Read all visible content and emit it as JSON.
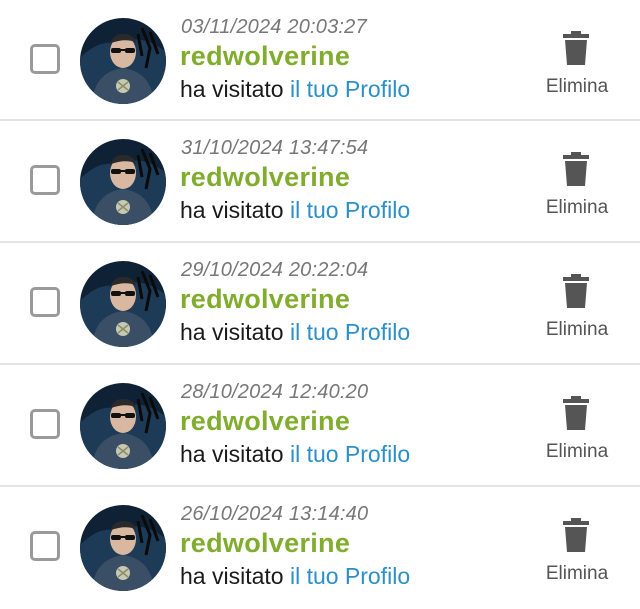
{
  "colors": {
    "username": "#80ad2e",
    "link": "#2b8fc9",
    "timestamp": "#777777",
    "checkbox_border": "#9a9a9a",
    "trash_icon": "#555555",
    "divider": "#e3e3e3"
  },
  "visits": [
    {
      "timestamp": "03/11/2024 20:03:27",
      "username": "redwolverine",
      "action_text": "ha visitato ",
      "link_text": "il tuo Profilo",
      "delete_label": "Elimina",
      "checked": false,
      "avatar_icon": "user-avatar"
    },
    {
      "timestamp": "31/10/2024 13:47:54",
      "username": "redwolverine",
      "action_text": "ha visitato ",
      "link_text": "il tuo Profilo",
      "delete_label": "Elimina",
      "checked": false,
      "avatar_icon": "user-avatar"
    },
    {
      "timestamp": "29/10/2024 20:22:04",
      "username": "redwolverine",
      "action_text": "ha visitato ",
      "link_text": "il tuo Profilo",
      "delete_label": "Elimina",
      "checked": false,
      "avatar_icon": "user-avatar"
    },
    {
      "timestamp": "28/10/2024 12:40:20",
      "username": "redwolverine",
      "action_text": "ha visitato ",
      "link_text": "il tuo Profilo",
      "delete_label": "Elimina",
      "checked": false,
      "avatar_icon": "user-avatar"
    },
    {
      "timestamp": "26/10/2024 13:14:40",
      "username": "redwolverine",
      "action_text": "ha visitato ",
      "link_text": "il tuo Profilo",
      "delete_label": "Elimina",
      "checked": false,
      "avatar_icon": "user-avatar"
    }
  ]
}
